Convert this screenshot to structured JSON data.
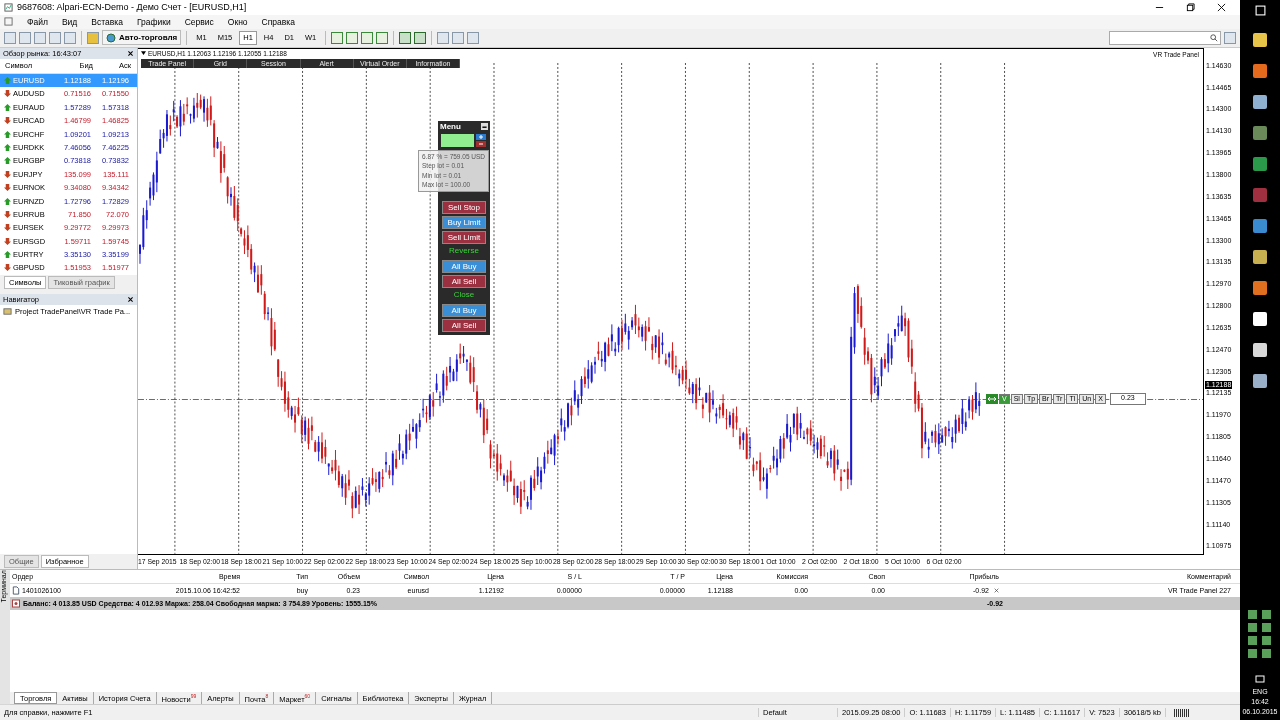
{
  "window": {
    "title": "9687608: Alpari-ECN-Demo - Демо Счет - [EURUSD,H1]"
  },
  "menu": [
    "Файл",
    "Вид",
    "Вставка",
    "Графики",
    "Сервис",
    "Окно",
    "Справка"
  ],
  "toolbar": {
    "autotrade": "Авто-торговля",
    "timeframes": [
      {
        "label": "M1",
        "selected": false
      },
      {
        "label": "M15",
        "selected": false
      },
      {
        "label": "H1",
        "selected": true
      },
      {
        "label": "H4",
        "selected": false
      },
      {
        "label": "D1",
        "selected": false
      },
      {
        "label": "W1",
        "selected": false
      }
    ]
  },
  "market_watch": {
    "title": "Обзор рынка: 16:43:07",
    "columns": [
      "Символ",
      "Бид",
      "Аск"
    ],
    "rows": [
      {
        "symbol": "EURUSD",
        "bid": "1.12188",
        "ask": "1.12196",
        "kind": "up",
        "selected": true
      },
      {
        "symbol": "AUDUSD",
        "bid": "0.71516",
        "ask": "0.71550",
        "kind": "down",
        "selected": false
      },
      {
        "symbol": "EURAUD",
        "bid": "1.57289",
        "ask": "1.57318",
        "kind": "up",
        "selected": false
      },
      {
        "symbol": "EURCAD",
        "bid": "1.46799",
        "ask": "1.46825",
        "kind": "down",
        "selected": false
      },
      {
        "symbol": "EURCHF",
        "bid": "1.09201",
        "ask": "1.09213",
        "kind": "up",
        "selected": false
      },
      {
        "symbol": "EURDKK",
        "bid": "7.46056",
        "ask": "7.46225",
        "kind": "up",
        "selected": false
      },
      {
        "symbol": "EURGBP",
        "bid": "0.73818",
        "ask": "0.73832",
        "kind": "up",
        "selected": false
      },
      {
        "symbol": "EURJPY",
        "bid": "135.099",
        "ask": "135.111",
        "kind": "down",
        "selected": false
      },
      {
        "symbol": "EURNOK",
        "bid": "9.34080",
        "ask": "9.34342",
        "kind": "down",
        "selected": false
      },
      {
        "symbol": "EURNZD",
        "bid": "1.72796",
        "ask": "1.72829",
        "kind": "up",
        "selected": false
      },
      {
        "symbol": "EURRUB",
        "bid": "71.850",
        "ask": "72.070",
        "kind": "down",
        "selected": false
      },
      {
        "symbol": "EURSEK",
        "bid": "9.29772",
        "ask": "9.29973",
        "kind": "down",
        "selected": false
      },
      {
        "symbol": "EURSGD",
        "bid": "1.59711",
        "ask": "1.59745",
        "kind": "down",
        "selected": false
      },
      {
        "symbol": "EURTRY",
        "bid": "3.35130",
        "ask": "3.35199",
        "kind": "up",
        "selected": false
      },
      {
        "symbol": "GBPUSD",
        "bid": "1.51953",
        "ask": "1.51977",
        "kind": "down",
        "selected": false
      }
    ],
    "tabs": [
      {
        "label": "Символы",
        "selected": true
      },
      {
        "label": "Тиковый график",
        "selected": false
      }
    ]
  },
  "navigator": {
    "title": "Навигатор",
    "items": [
      "Project TradePanel\\VR Trade Pa..."
    ],
    "tabs": [
      {
        "label": "Общие",
        "selected": false
      },
      {
        "label": "Избранное",
        "selected": true
      }
    ]
  },
  "chart": {
    "header": "EURUSD,H1  1.12063 1.12196 1.12055 1.12188",
    "corner_label": "VR Trade Panel",
    "panel_tabs": [
      "Trade Panel",
      "Grid",
      "Session",
      "Alert",
      "Virtual Order",
      "Information"
    ],
    "menu_panel": {
      "title": "Menu",
      "tooltip": [
        "6.87 % = 759.05 USD",
        "Step lot = 0.01",
        "Min lot = 0.01",
        "Max lot = 100.00"
      ],
      "buttons": [
        {
          "label": "Sell Stop",
          "kind": "sell"
        },
        {
          "label": "Buy Limit",
          "kind": "buy"
        },
        {
          "label": "Sell Limit",
          "kind": "sell"
        },
        {
          "label": "Reverse",
          "kind": "heading"
        },
        {
          "label": "All Buy",
          "kind": "buy"
        },
        {
          "label": "All Sell",
          "kind": "sell"
        },
        {
          "label": "Close",
          "kind": "heading"
        },
        {
          "label": "All Buy",
          "kind": "buy"
        },
        {
          "label": "All Sell",
          "kind": "sell"
        }
      ]
    },
    "line_buttons": [
      "V",
      "Sl",
      "Tp",
      "Br",
      "Tr",
      "Tl",
      "Un",
      "X"
    ],
    "line_lot": "0.23",
    "current_price": "1.12188",
    "price_labels": [
      "1.14630",
      "1.14465",
      "1.14300",
      "1.14130",
      "1.13965",
      "1.13800",
      "1.13635",
      "1.13465",
      "1.13300",
      "1.13135",
      "1.12970",
      "1.12800",
      "1.12635",
      "1.12470",
      "1.12305",
      "1.12135",
      "1.11970",
      "1.11805",
      "1.11640",
      "1.11470",
      "1.11305",
      "1.11140",
      "1.10975"
    ],
    "time_labels": [
      "17 Sep 2015",
      "18 Sep 02:00",
      "18 Sep 18:00",
      "21 Sep 10:00",
      "22 Sep 02:00",
      "22 Sep 18:00",
      "23 Sep 10:00",
      "24 Sep 02:00",
      "24 Sep 18:00",
      "25 Sep 10:00",
      "28 Sep 02:00",
      "28 Sep 18:00",
      "29 Sep 10:00",
      "30 Sep 02:00",
      "30 Sep 18:00",
      "1 Oct 10:00",
      "2 Oct 02:00",
      "2 Oct 18:00",
      "5 Oct 10:00",
      "6 Oct 02:00"
    ]
  },
  "terminal": {
    "side_label": "Терминал",
    "columns": [
      "Ордер",
      "Время",
      "Тип",
      "Объем",
      "Символ",
      "Цена",
      "S / L",
      "T / P",
      "Цена",
      "Комиссия",
      "Своп",
      "Прибыль",
      "Комментарий"
    ],
    "rows": [
      [
        "1401026100",
        "2015.10.06 16:42:52",
        "buy",
        "0.23",
        "eurusd",
        "1.12192",
        "0.00000",
        "0.00000",
        "1.12188",
        "0.00",
        "0.00",
        "-0.92",
        "VR Trade Panel 227"
      ]
    ],
    "balance": "Баланс: 4 013.85 USD  Средства: 4 012.93  Маржа: 258.04  Свободная маржа: 3 754.89  Уровень: 1555.15%",
    "balance_profit": "-0.92",
    "tabs": [
      {
        "label": "Торговля",
        "selected": true
      },
      {
        "label": "Активы",
        "selected": false
      },
      {
        "label": "История Счета",
        "selected": false
      },
      {
        "label": "Новости",
        "badge": "99",
        "selected": false
      },
      {
        "label": "Алерты",
        "selected": false
      },
      {
        "label": "Почта",
        "badge": "8",
        "selected": false
      },
      {
        "label": "Маркет",
        "badge": "60",
        "selected": false
      },
      {
        "label": "Сигналы",
        "selected": false
      },
      {
        "label": "Библиотека",
        "selected": false
      },
      {
        "label": "Эксперты",
        "selected": false
      },
      {
        "label": "Журнал",
        "selected": false
      }
    ]
  },
  "status_bar": [
    "Для справки, нажмите F1",
    "Default",
    "2015.09.25 08:00",
    "O: 1.11683",
    "H: 1.11759",
    "L: 1.11485",
    "C: 1.11617",
    "V: 7523",
    "30618/5 kb"
  ],
  "taskbar": {
    "language": "ENG",
    "time": "16:42",
    "date": "06.10.2015"
  }
}
